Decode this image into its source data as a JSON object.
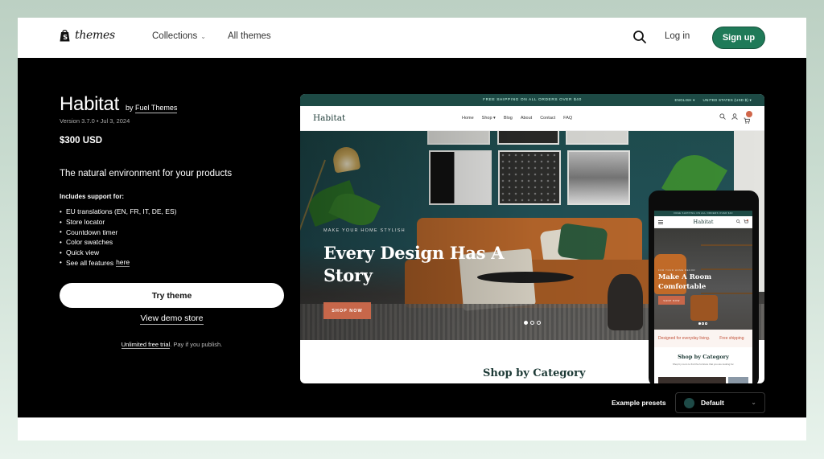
{
  "header": {
    "logo_text": "themes",
    "nav": [
      {
        "label": "Collections",
        "has_dropdown": true
      },
      {
        "label": "All themes",
        "has_dropdown": false
      }
    ],
    "search_icon": "search-icon",
    "login_label": "Log in",
    "signup_label": "Sign up",
    "accent_color": "#1f7a58"
  },
  "theme": {
    "name": "Habitat",
    "by_prefix": "by",
    "author": "Fuel Themes",
    "version_line": "Version 3.7.0 • Jul 3, 2024",
    "price": "$300 USD",
    "tagline": "The natural environment for your products",
    "support_heading": "Includes support for:",
    "features": [
      "EU translations (EN, FR, IT, DE, ES)",
      "Store locator",
      "Countdown timer",
      "Color swatches",
      "Quick view"
    ],
    "see_all_prefix": "See all features",
    "see_all_link": "here",
    "try_label": "Try theme",
    "demo_label": "View demo store",
    "trial_link": "Unlimited free trial",
    "trial_rest": ". Pay if you publish."
  },
  "preview": {
    "announcement": "FREE SHIPPING ON ALL ORDERS OVER $40",
    "language": "ENGLISH ▾",
    "currency": "UNITED STATES (USD $) ▾",
    "store_logo": "Habitat",
    "store_nav": [
      "Home",
      "Shop ▾",
      "Blog",
      "About",
      "Contact",
      "FAQ"
    ],
    "hero_eyebrow": "MAKE YOUR HOME STYLISH",
    "hero_headline": "Every Design Has A Story",
    "hero_cta": "SHOP NOW",
    "slide_count": 3,
    "active_slide": 1,
    "section_heading": "Shop by Category",
    "mobile": {
      "announcement": "FREE SHIPPING ON ALL ORDERS OVER $40",
      "logo": "Habitat",
      "hero_eyebrow": "FOR YOUR HOME DECOR",
      "hero_headline": "Make A Room Comfortable",
      "hero_cta": "SHOP NOW",
      "marquee": [
        "Designed for everyday living.",
        "Free shipping"
      ],
      "section_heading": "Shop by Category",
      "section_sub": "Shop by room to find the furniture that you are looking for."
    }
  },
  "presets": {
    "label": "Example presets",
    "selected": "Default",
    "swatch_color": "#1e4a47"
  }
}
